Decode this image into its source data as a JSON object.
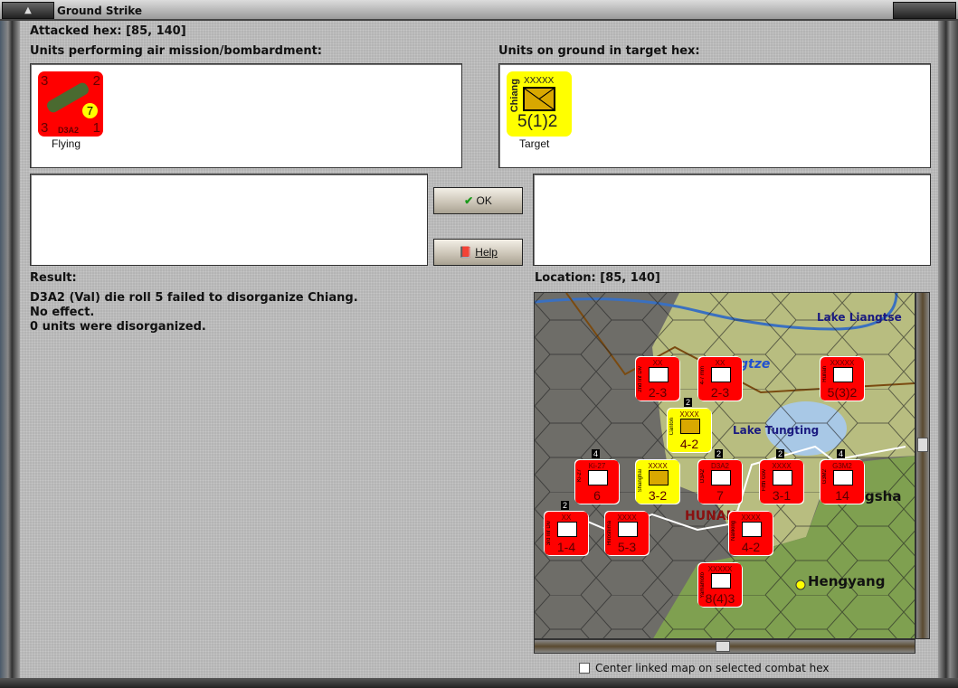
{
  "window": {
    "title": "Ground Strike"
  },
  "attacked_hex": "Attacked hex:  [85, 140]",
  "air_units": {
    "label": "Units performing air mission/bombardment:",
    "unit": {
      "name": "D3A2",
      "top_left": "3",
      "top_right": "2",
      "bottom_left": "3",
      "bottom_right": "1",
      "badge": "7",
      "status": "Flying"
    }
  },
  "ground_units": {
    "label": "Units on ground in target hex:",
    "unit": {
      "name": "Chiang",
      "size": "XXXXX",
      "strength": "5(1)2",
      "status": "Target"
    }
  },
  "buttons": {
    "ok": "OK",
    "help": "Help"
  },
  "result": {
    "label": "Result:",
    "lines": [
      "D3A2 (Val) die roll 5 failed to disorganize Chiang.",
      "No effect.",
      "0 units were disorganized."
    ]
  },
  "location": {
    "label": "Location:  [85, 140]"
  },
  "map": {
    "labels": {
      "lake_liangtse": "Lake Liangtse",
      "yangtze": "gtze",
      "lake_tungting": "Lake Tungting",
      "hunan": "HUNAN",
      "hengyang": "Hengyang",
      "changsha": "gsha"
    },
    "counters": [
      {
        "color": "red",
        "size": "XX",
        "strength": "2-3",
        "name": "2nd Inf Div"
      },
      {
        "color": "red",
        "size": "XX",
        "strength": "2-3",
        "name": "4-7 mm"
      },
      {
        "color": "red",
        "size": "XXXXX",
        "strength": "5(3)2",
        "name": "Hunan"
      },
      {
        "color": "yel",
        "size": "XXXX",
        "strength": "4-2",
        "name": "Canton",
        "stack": "2"
      },
      {
        "color": "red",
        "size": "Ki-27",
        "strength": "6",
        "name": "Ki-27",
        "stack": "4"
      },
      {
        "color": "yel",
        "size": "XXXX",
        "strength": "3-2",
        "name": "Shanghai"
      },
      {
        "color": "red",
        "size": "D3A2",
        "strength": "7",
        "name": "D3A2",
        "stack": "2"
      },
      {
        "color": "red",
        "size": "XXXX",
        "strength": "3-1",
        "name": "Fifth Gov",
        "stack": "2"
      },
      {
        "color": "red",
        "size": "G3M2",
        "strength": "14",
        "name": "G3M2",
        "stack": "4"
      },
      {
        "color": "red",
        "size": "XX",
        "strength": "1-4",
        "name": "3rd Inf Div",
        "stack": "2"
      },
      {
        "color": "red",
        "size": "XXXX",
        "strength": "5-3",
        "name": "Hiroshima"
      },
      {
        "color": "red",
        "size": "XXXX",
        "strength": "4-2",
        "name": "Nanking"
      },
      {
        "color": "red",
        "size": "XXXXX",
        "strength": "8(4)3",
        "name": "Yamamoto"
      }
    ]
  },
  "checkbox": {
    "label": "Center linked map on selected combat hex",
    "checked": false
  }
}
